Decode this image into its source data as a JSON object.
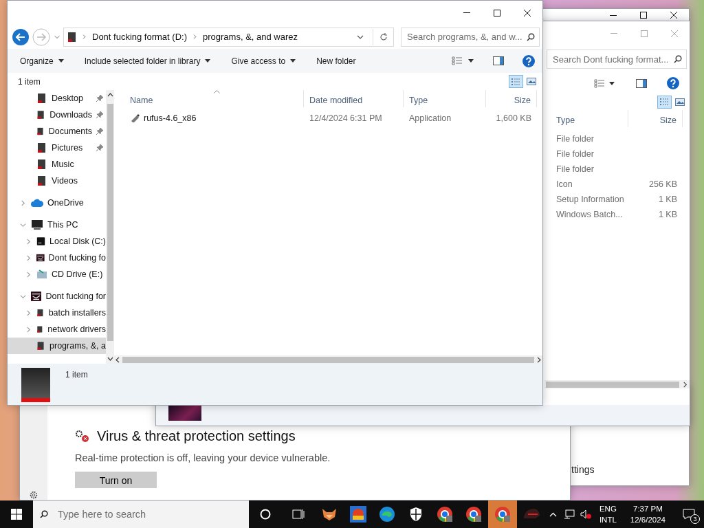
{
  "front_window": {
    "address": {
      "segments": [
        "Dont fucking format (D:)",
        "programs, &, and warez"
      ]
    },
    "search": {
      "placeholder": "Search programs, &, and w..."
    },
    "toolbar": [
      {
        "label": "Organize",
        "dropdown": true
      },
      {
        "label": "Include selected folder in library",
        "dropdown": true
      },
      {
        "label": "Give access to",
        "dropdown": true
      },
      {
        "label": "New folder",
        "dropdown": false
      }
    ],
    "item_count": "1 item",
    "nav_tree": [
      {
        "label": "Desktop",
        "kind": "folder",
        "pinned": true,
        "selected": false
      },
      {
        "label": "Downloads",
        "kind": "folder",
        "pinned": true,
        "selected": false
      },
      {
        "label": "Documents",
        "kind": "folder",
        "pinned": true,
        "selected": false
      },
      {
        "label": "Pictures",
        "kind": "folder",
        "pinned": true,
        "selected": false
      },
      {
        "label": "Music",
        "kind": "folder",
        "pinned": false,
        "selected": false
      },
      {
        "label": "Videos",
        "kind": "folder",
        "pinned": false,
        "selected": false
      },
      {
        "label": "OneDrive",
        "kind": "cloud",
        "expanded": false,
        "selected": false
      },
      {
        "label": "This PC",
        "kind": "pc",
        "expanded": true,
        "selected": false,
        "children": [
          {
            "label": "Local Disk (C:)",
            "kind": "disk",
            "expanded": false,
            "selected": false
          },
          {
            "label": "Dont fucking fo",
            "kind": "drive",
            "expanded": false,
            "selected": false
          },
          {
            "label": "CD Drive (E:)",
            "kind": "disc",
            "expanded": false,
            "selected": false
          }
        ]
      },
      {
        "label": "Dont fucking for",
        "kind": "drive",
        "expanded": true,
        "selected": false,
        "children": [
          {
            "label": "batch installers",
            "kind": "folder",
            "expanded": false,
            "selected": false
          },
          {
            "label": "network drivers",
            "kind": "folder",
            "expanded": false,
            "selected": false
          },
          {
            "label": "programs, &, a",
            "kind": "folder",
            "selected": true
          }
        ]
      }
    ],
    "columns": [
      {
        "label": "Name",
        "sorted": true
      },
      {
        "label": "Date modified",
        "sorted": false
      },
      {
        "label": "Type",
        "sorted": false
      },
      {
        "label": "Size",
        "sorted": false
      }
    ],
    "rows": [
      {
        "name": "rufus-4.6_x86",
        "date": "12/4/2024 6:31 PM",
        "type": "Application",
        "size": "1,600 KB"
      }
    ],
    "details": "1 item"
  },
  "back_window": {
    "search": {
      "placeholder": "Search Dont fucking format..."
    },
    "columns": [
      "Type",
      "Size"
    ],
    "rows": [
      {
        "type": "File folder"
      },
      {
        "type": "File folder"
      },
      {
        "type": "File folder"
      },
      {
        "type": "Icon",
        "size": "256 KB"
      },
      {
        "type": "Setup Information",
        "size": "1 KB"
      },
      {
        "type": "Windows Batch...",
        "size": "1 KB"
      }
    ]
  },
  "security": {
    "heading": "Virus & threat protection settings",
    "description": "Real-time protection is off, leaving your device vulnerable.",
    "button": "Turn on"
  },
  "other_window": {
    "text": "ttings"
  },
  "taskbar": {
    "search": {
      "placeholder": "Type here to search"
    },
    "apps": [
      {
        "kind": "fox",
        "active": false
      },
      {
        "kind": "game",
        "active": false
      },
      {
        "kind": "wave",
        "active": false
      },
      {
        "kind": "shield",
        "active": false
      },
      {
        "kind": "circle",
        "active": false
      },
      {
        "kind": "circle",
        "active": false
      },
      {
        "kind": "circle",
        "active": true
      },
      {
        "kind": "helmet",
        "active": false
      }
    ],
    "language": [
      "ENG",
      "INTL"
    ],
    "time": "7:37 PM",
    "date": "12/6/2024",
    "notifications": "3"
  }
}
